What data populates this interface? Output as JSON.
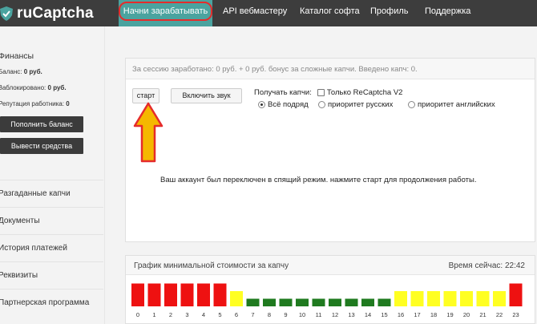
{
  "logo": {
    "text": "ruCaptcha",
    "icon": "shield-logo-icon"
  },
  "nav": [
    {
      "label": "Начни зарабатывать",
      "active": true
    },
    {
      "label": "API вебмастеру"
    },
    {
      "label": "Каталог софта"
    },
    {
      "label": "Профиль"
    },
    {
      "label": "Поддержка"
    }
  ],
  "sidebar": {
    "finance_title": "Финансы",
    "balance_label": "Баланс:",
    "balance_value": "0 руб.",
    "blocked_label": "Заблокировано:",
    "blocked_value": "0 руб.",
    "reputation_label": "Репутация работника:",
    "reputation_value": "0",
    "topup_button": "Пополнить баланс",
    "withdraw_button": "Вывести средства",
    "menu": [
      "Разгаданные капчи",
      "Документы",
      "История платежей",
      "Реквизиты",
      "Партнерская программа"
    ]
  },
  "main": {
    "session_text": "За сессию заработано: 0 руб. + 0 руб. бонус за сложные капчи. Введено капч: 0.",
    "start_button": "старт",
    "sound_button": "Включить звук",
    "receive_label": "Получать капчи:",
    "recaptcha_only": "Только ReCaptcha V2",
    "recaptcha_checked": false,
    "radio_all": "Всё подряд",
    "radio_russian": "приоритет русских",
    "radio_english": "приоритет английских",
    "radio_selected": "all",
    "sleep_message": "Ваш аккаунт был переключен в спящий режим. нажмите старт для продолжения работы."
  },
  "annotation": {
    "arrow_color": "#f5b800",
    "outline_color": "#e52b2b",
    "highlight_color": "#e52b2b"
  },
  "colors": {
    "accent": "#4aa39f",
    "header": "#3d3d3d",
    "bar_red": "#ee1111",
    "bar_yellow": "#ffff22",
    "bar_green": "#1f7a1f"
  },
  "chart_data": {
    "type": "bar",
    "title": "График минимальной стоимости за капчу",
    "time_label": "Время сейчас:",
    "time_value": "22:42",
    "categories": [
      "0",
      "1",
      "2",
      "3",
      "4",
      "5",
      "6",
      "7",
      "8",
      "9",
      "10",
      "11",
      "12",
      "13",
      "14",
      "15",
      "16",
      "17",
      "18",
      "19",
      "20",
      "21",
      "22",
      "23"
    ],
    "values": [
      3,
      3,
      3,
      3,
      3,
      3,
      2,
      1,
      1,
      1,
      1,
      1,
      1,
      1,
      1,
      1,
      2,
      2,
      2,
      2,
      2,
      2,
      2,
      3
    ],
    "levels": [
      "red",
      "red",
      "red",
      "red",
      "red",
      "red",
      "yellow",
      "green",
      "green",
      "green",
      "green",
      "green",
      "green",
      "green",
      "green",
      "green",
      "yellow",
      "yellow",
      "yellow",
      "yellow",
      "yellow",
      "yellow",
      "yellow",
      "red"
    ]
  }
}
